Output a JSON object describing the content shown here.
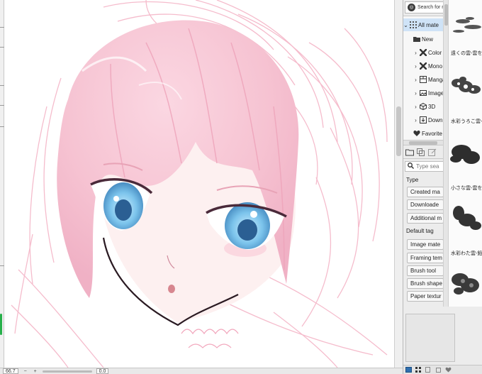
{
  "colors": {
    "panel_bg": "#ececec",
    "selected_row": "#cfe3f7",
    "hair_pink": "#f6c3d2",
    "eye_blue": "#7cc4ec",
    "sketch_line": "#f2a6bc",
    "status_green": "#27b04b"
  },
  "status_bar": {
    "zoom": "66.7",
    "minus_label": "−",
    "plus_label": "+",
    "rotation": "0.0"
  },
  "panel": {
    "search_label": "Search for m",
    "tree": [
      {
        "label": "All mate",
        "icon": "grid-icon",
        "expanded": true,
        "selected": true
      },
      {
        "label": "New",
        "icon": "folder-icon"
      },
      {
        "label": "Color",
        "icon": "x-pattern-icon"
      },
      {
        "label": "Mono",
        "icon": "x-pattern-icon"
      },
      {
        "label": "Manga",
        "icon": "manga-icon"
      },
      {
        "label": "Image",
        "icon": "image-icon"
      },
      {
        "label": "3D",
        "icon": "cube-icon"
      },
      {
        "label": "Down",
        "icon": "download-icon"
      },
      {
        "label": "Favorite",
        "icon": "heart-icon"
      }
    ],
    "tag_search_placeholder": "Type sea",
    "tag_headings": {
      "type": "Type",
      "default_tag": "Default tag"
    },
    "type_tags": [
      "Created ma",
      "Downloade",
      "Additional m"
    ],
    "default_tags": [
      "Image mate",
      "Framing tem",
      "Brush tool",
      "Brush shape",
      "Paper textur"
    ]
  },
  "materials": [
    {
      "label": ""
    },
    {
      "label": "遠くの雲-雲を描"
    },
    {
      "label": "水彩うろこ雲-鉛"
    },
    {
      "label": "小さな雲-雲を描"
    },
    {
      "label": "水彩わた雲-鉛"
    }
  ]
}
